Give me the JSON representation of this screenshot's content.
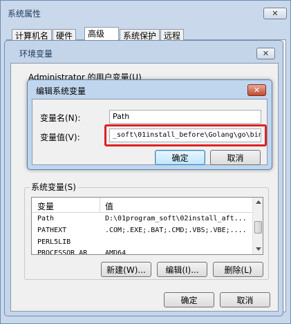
{
  "system_props": {
    "title": "系统属性",
    "close": "✕",
    "tabs": [
      "计算机名",
      "硬件",
      "高级",
      "系统保护",
      "远程"
    ]
  },
  "env_vars": {
    "title": "环境变量",
    "close": "✕",
    "user_section_partial": "Administrator 的用户变量(U)",
    "system_section": "系统变量(S)",
    "columns": [
      "变量",
      "值"
    ],
    "rows": [
      {
        "name": "Path",
        "value": "D:\\01program_soft\\02install_aft..."
      },
      {
        "name": "PATHEXT",
        "value": ".COM;.EXE;.BAT;.CMD;.VBS;.VBE;...."
      },
      {
        "name": "PERL5LIB",
        "value": ""
      },
      {
        "name": "PROCESSOR_AR",
        "value": "AMD64"
      }
    ],
    "new_btn": "新建(W)...",
    "edit_btn": "编辑(I)...",
    "delete_btn": "删除(L)",
    "ok_btn": "确定",
    "cancel_btn": "取消"
  },
  "edit_dialog": {
    "title": "编辑系统变量",
    "close": "✕",
    "name_label": "变量名(N):",
    "name_value": "Path",
    "value_label": "变量值(V):",
    "value_value": "_soft\\01install_before\\Golang\\go\\bin",
    "ok_btn": "确定",
    "cancel_btn": "取消"
  },
  "colors": {
    "highlight": "#e02020",
    "accent": "#3c7fb1"
  }
}
